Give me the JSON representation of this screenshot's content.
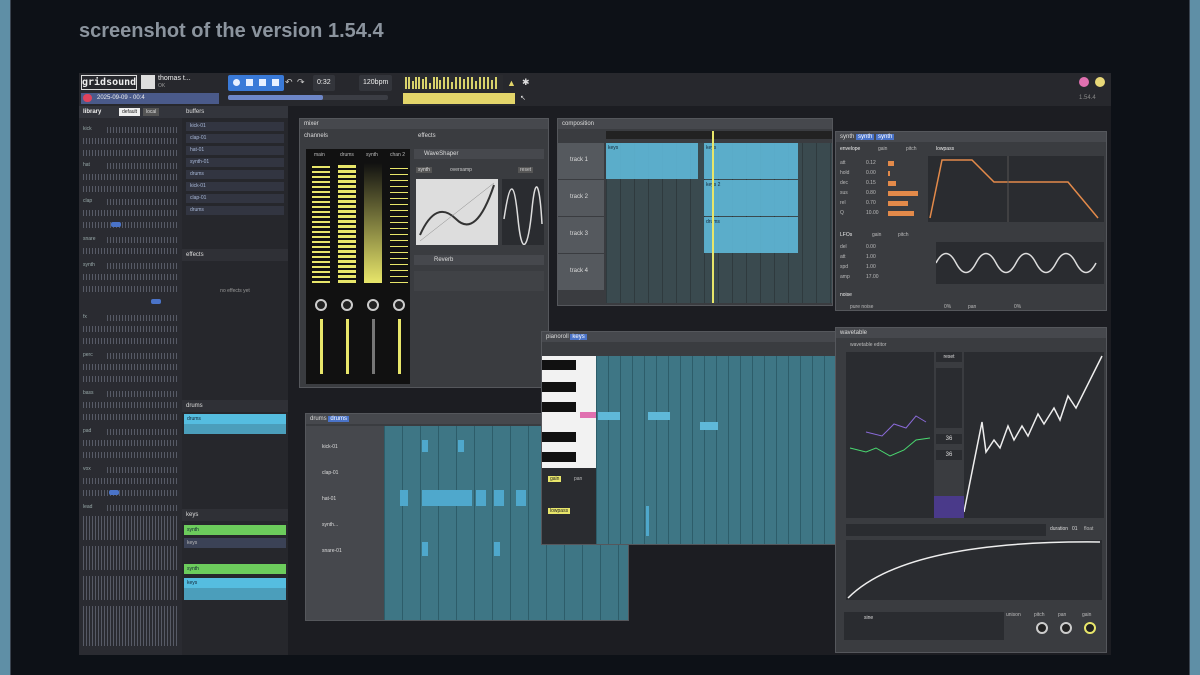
{
  "caption": "screenshot of the version 1.54.4",
  "header": {
    "logo": "gridsound",
    "username": "thomas t...",
    "user_status": "OK",
    "date": "2025-09-09 - 00:4",
    "time": "0:32",
    "bpm": "120bpm",
    "version": "1.54.4"
  },
  "library": {
    "title": "library",
    "tab_default": "default",
    "tab_local": "local",
    "items": [
      "kick",
      "hat",
      "clap",
      "snare",
      "synth",
      "fx",
      "perc",
      "bass",
      "pad",
      "vox",
      "lead"
    ]
  },
  "buffers": {
    "title": "buffers",
    "items": [
      "kick-01",
      "clap-01",
      "hat-01",
      "synth-01",
      "drums"
    ]
  },
  "effects": {
    "title": "effects",
    "empty": "no effects yet"
  },
  "drums_label": "drums",
  "drums_bar": "drums",
  "keys_label": "keys",
  "keys_bars": [
    "synth",
    "keys",
    "synth",
    "keys"
  ],
  "mixer": {
    "title": "mixer",
    "channels_tab": "channels",
    "effects_tab": "effects",
    "channel_names": [
      "main",
      "drums",
      "synth",
      "chan 2"
    ],
    "waveshaper": "WaveShaper",
    "reverb": "Reverb",
    "synth_btn": "synth",
    "oversample": "oversamp",
    "reset": "reset"
  },
  "composition": {
    "title": "composition",
    "tracks": [
      "track 1",
      "track 2",
      "track 3",
      "track 4"
    ],
    "clips": [
      "keys",
      "keys",
      "keys 2",
      "drums"
    ]
  },
  "synth": {
    "title": "synth",
    "badge": "synth",
    "target": "synth",
    "tabs": [
      "envelope",
      "gain",
      "pitch",
      "lowpass"
    ],
    "env_labels": [
      "att",
      "hold",
      "dec",
      "sus",
      "rel",
      "Q"
    ],
    "env_values": [
      "0.12",
      "0.00",
      "0.15",
      "0.80",
      "0.70",
      "10.00"
    ],
    "lfo_tabs": [
      "LFOs",
      "gain",
      "pitch"
    ],
    "lfo_labels": [
      "del",
      "att",
      "spd",
      "amp"
    ],
    "lfo_values": [
      "0.00",
      "1.00",
      "1.00",
      "17.00"
    ],
    "noise": "noise",
    "pure": "pure noise",
    "pct1": "0%",
    "pan": "pan",
    "pct2": "0%"
  },
  "drums_win": {
    "title": "drums",
    "badge": "drums",
    "rows": [
      "kick-01",
      "clap-01",
      "hat-01",
      "synth...",
      "snare-01"
    ]
  },
  "piano": {
    "title": "pianoroll",
    "badge": "keys",
    "gain": "gain",
    "pan": "pan",
    "lowpass": "lowpass"
  },
  "wavetable": {
    "title": "wavetable",
    "subtitle": "wavetable editor",
    "reset": "reset",
    "n1": "36",
    "n2": "36",
    "duration": "duration",
    "dur_val": "01",
    "float": "float",
    "osc_name": "sine",
    "unison": "unison",
    "pitch": "pitch",
    "pan": "pan",
    "gain": "gain"
  }
}
